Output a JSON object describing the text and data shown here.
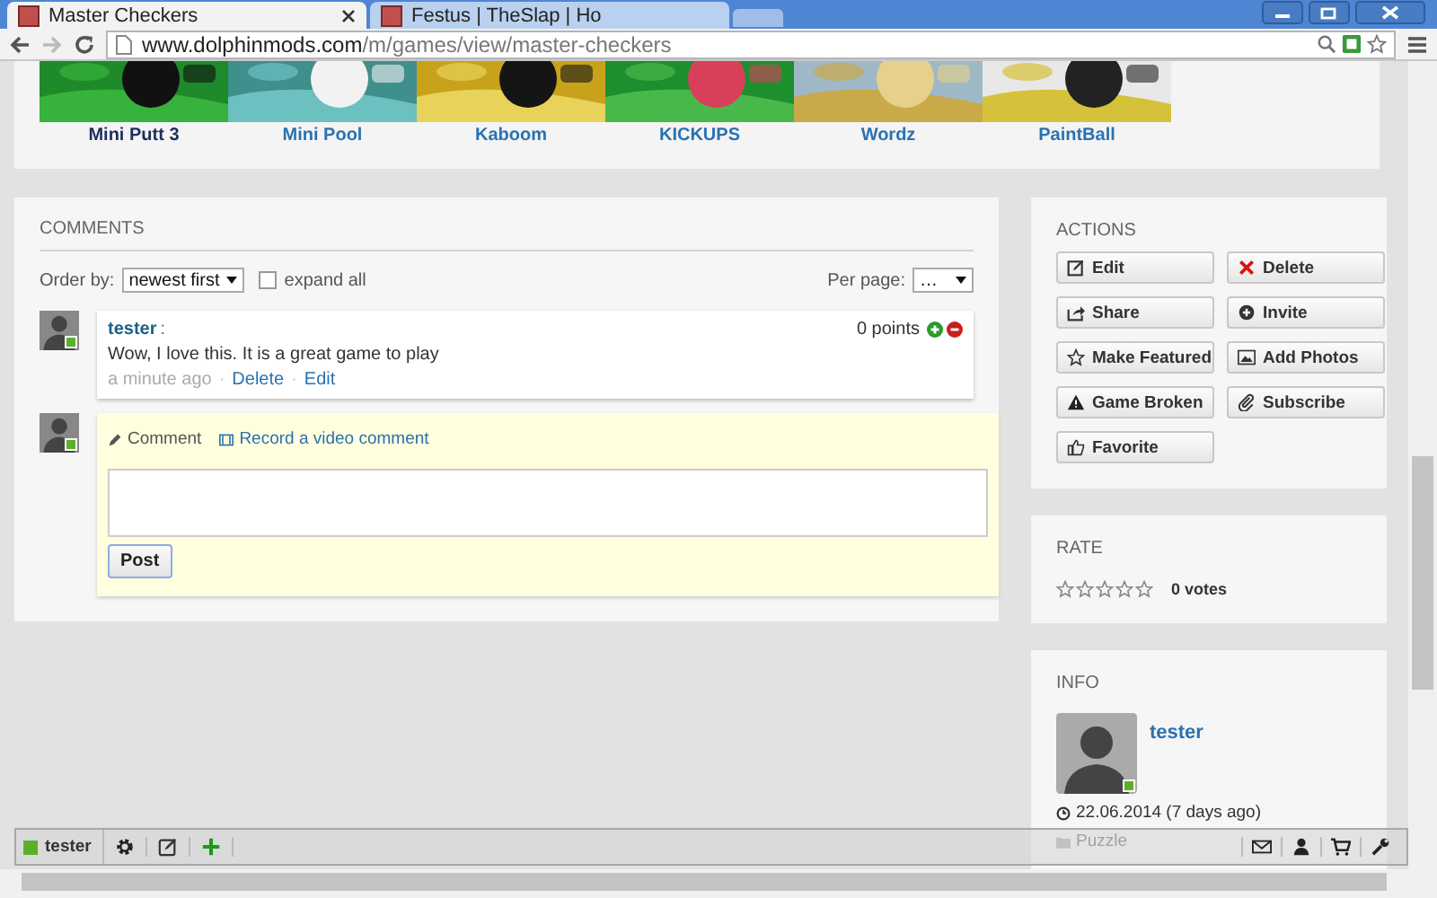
{
  "browser": {
    "tabs": [
      {
        "title": "Master Checkers",
        "selected": true
      },
      {
        "title": "Festus | TheSlap | Ho",
        "selected": false
      }
    ],
    "url_host": "www.dolphinmods.com",
    "url_path": "/m/games/view/master-checkers"
  },
  "games": [
    {
      "title": "Mini Putt 3",
      "visited": true
    },
    {
      "title": "Mini Pool",
      "visited": false
    },
    {
      "title": "Kaboom",
      "visited": false
    },
    {
      "title": "KICKUPS",
      "visited": false
    },
    {
      "title": "Wordz",
      "visited": false
    },
    {
      "title": "PaintBall",
      "visited": false
    }
  ],
  "comments": {
    "title": "COMMENTS",
    "order_label": "Order by:",
    "order_value": "newest first",
    "expand_all": {
      "label": "expand all",
      "checked": false
    },
    "per_page_label": "Per page:",
    "per_page_value": "…",
    "items": [
      {
        "author": "tester",
        "author_sep": ":",
        "online": true,
        "points": "0 points",
        "text": "Wow, I love this. It is a great game to play",
        "time": "a minute ago",
        "separator": "·",
        "actions": [
          "Delete",
          "Edit"
        ]
      }
    ],
    "composer": {
      "online": true,
      "tabs": [
        {
          "label": "Comment",
          "selected": true,
          "kind": "text"
        },
        {
          "label": "Record a video comment",
          "selected": false,
          "kind": "video"
        }
      ],
      "post": "Post"
    }
  },
  "actions": {
    "title": "ACTIONS",
    "buttons": [
      {
        "label": "Edit",
        "kind": "edit"
      },
      {
        "label": "Delete",
        "kind": "delete"
      },
      {
        "label": "Share",
        "kind": "share"
      },
      {
        "label": "Invite",
        "kind": "invite"
      },
      {
        "label": "Make Featured",
        "kind": "featured"
      },
      {
        "label": "Add Photos",
        "kind": "photos"
      },
      {
        "label": "Game Broken",
        "kind": "broken"
      },
      {
        "label": "Subscribe",
        "kind": "subscribe"
      },
      {
        "label": "Favorite",
        "kind": "favorite"
      }
    ]
  },
  "rate": {
    "title": "RATE",
    "stars": 0,
    "votes": "0 votes"
  },
  "info": {
    "title": "INFO",
    "user": "tester",
    "online": true,
    "date": "22.06.2014 (7 days ago)",
    "category": "Puzzle"
  },
  "toolbar": {
    "user": "tester",
    "online": true
  }
}
